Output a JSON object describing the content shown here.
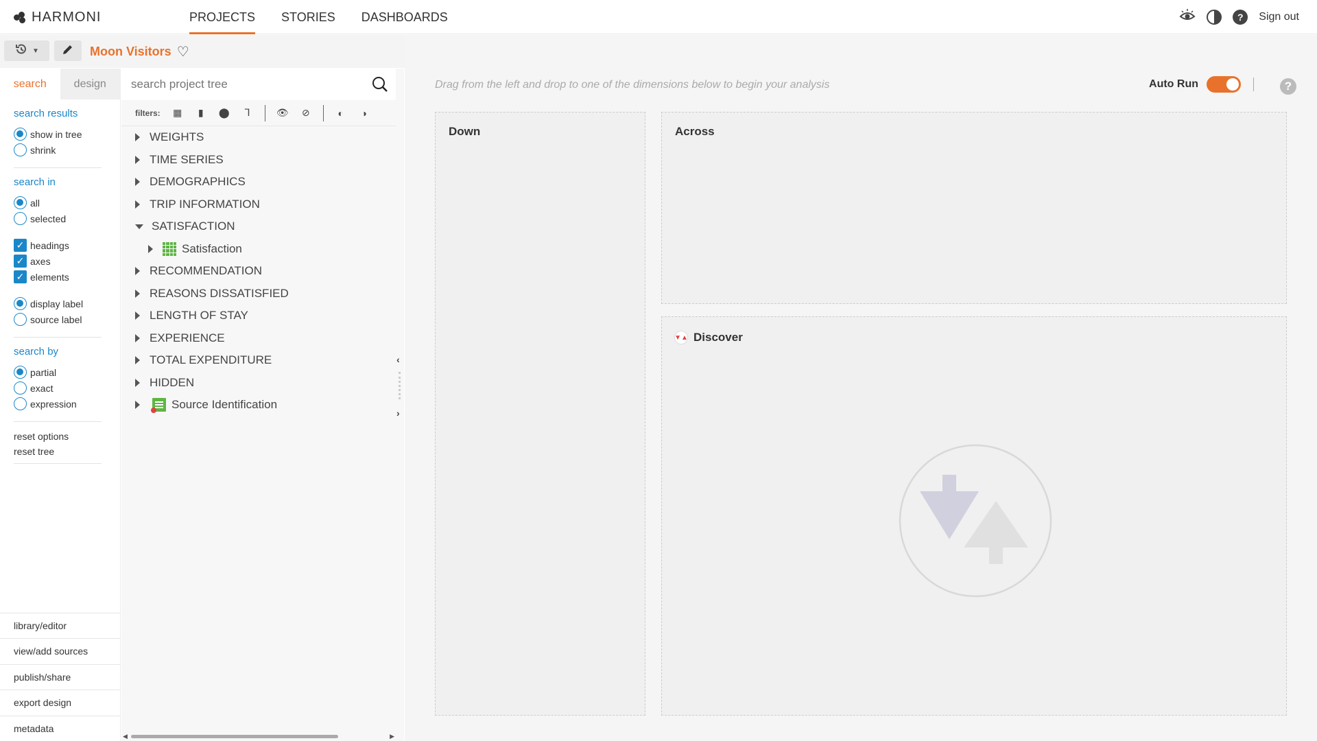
{
  "brand": {
    "name": "HARMONI"
  },
  "nav": {
    "tabs": [
      {
        "label": "PROJECTS",
        "active": true
      },
      {
        "label": "STORIES",
        "active": false
      },
      {
        "label": "DASHBOARDS",
        "active": false
      }
    ]
  },
  "header": {
    "sign_out": "Sign out",
    "help_glyph": "?"
  },
  "project": {
    "title": "Moon Visitors"
  },
  "left": {
    "tabs": {
      "search": "search",
      "design": "design"
    },
    "search_results": {
      "title": "search results",
      "show_in_tree": "show in tree",
      "shrink": "shrink",
      "selected": "show in tree"
    },
    "search_in": {
      "title": "search in",
      "all": "all",
      "selected_opt": "selected",
      "selected": "all"
    },
    "checks": {
      "headings": "headings",
      "axes": "axes",
      "elements": "elements"
    },
    "labels": {
      "display": "display label",
      "source": "source label",
      "selected": "display label"
    },
    "search_by": {
      "title": "search by",
      "partial": "partial",
      "exact": "exact",
      "expression": "expression",
      "selected": "partial"
    },
    "reset": {
      "options": "reset options",
      "tree": "reset tree"
    },
    "bottom": {
      "library": "library/editor",
      "sources": "view/add sources",
      "publish": "publish/share",
      "export": "export design",
      "metadata": "metadata"
    }
  },
  "tree": {
    "search_placeholder": "search project tree",
    "filters_label": "filters:",
    "nodes": [
      {
        "label": "WEIGHTS"
      },
      {
        "label": "TIME SERIES"
      },
      {
        "label": "DEMOGRAPHICS"
      },
      {
        "label": "TRIP INFORMATION"
      },
      {
        "label": "SATISFACTION",
        "expanded": true
      },
      {
        "label": "Satisfaction",
        "child": true
      },
      {
        "label": "RECOMMENDATION"
      },
      {
        "label": "REASONS DISSATISFIED"
      },
      {
        "label": "LENGTH OF STAY"
      },
      {
        "label": "EXPERIENCE"
      },
      {
        "label": "TOTAL EXPENDITURE"
      },
      {
        "label": "HIDDEN"
      },
      {
        "label": "Source Identification",
        "source": true
      }
    ]
  },
  "main": {
    "hint": "Drag from the left and drop to one of the dimensions below to begin your analysis",
    "auto_run": {
      "label": "Auto Run",
      "on": true
    },
    "help_glyph": "?",
    "zones": {
      "down": "Down",
      "across": "Across",
      "discover": "Discover"
    }
  },
  "colors": {
    "accent": "#e8722c",
    "link": "#1a87c9",
    "tree_icon": "#5fb544"
  }
}
